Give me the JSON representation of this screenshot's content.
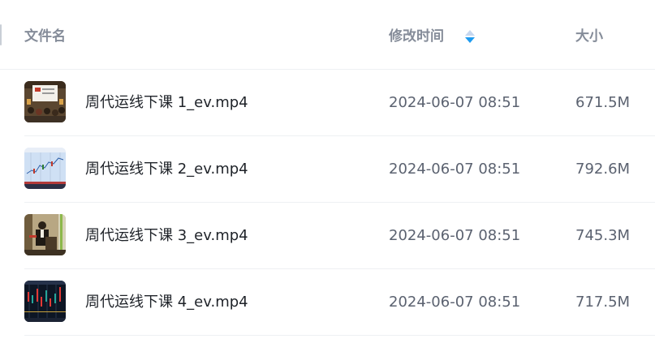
{
  "table": {
    "columns": {
      "name": "文件名",
      "modified": "修改时间",
      "size": "大小"
    },
    "sort": {
      "icon": "sort-icon",
      "active_color": "#1e9bf0",
      "inactive_color": "#c6d7ef"
    },
    "rows": [
      {
        "name": "周代运线下课 1_ev.mp4",
        "modified": "2024-06-07 08:51",
        "size": "671.5M",
        "thumbnail": "video-thumbnail-classroom"
      },
      {
        "name": "周代运线下课 2_ev.mp4",
        "modified": "2024-06-07 08:51",
        "size": "792.6M",
        "thumbnail": "video-thumbnail-chart"
      },
      {
        "name": "周代运线下课 3_ev.mp4",
        "modified": "2024-06-07 08:51",
        "size": "745.3M",
        "thumbnail": "video-thumbnail-speaker"
      },
      {
        "name": "周代运线下课 4_ev.mp4",
        "modified": "2024-06-07 08:51",
        "size": "717.5M",
        "thumbnail": "video-thumbnail-dark-chart"
      }
    ]
  }
}
